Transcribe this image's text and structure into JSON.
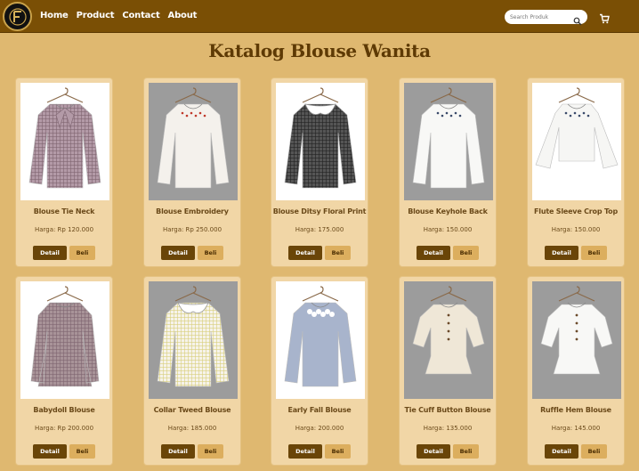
{
  "nav": {
    "links": [
      "Home",
      "Product",
      "Contact",
      "About"
    ],
    "search_placeholder": "Search Produk"
  },
  "page_title": "Katalog Blouse Wanita",
  "products": [
    {
      "name": "Blouse Tie Neck",
      "price": "Harga: Rp 120.000",
      "detail_label": "Detail",
      "buy_label": "Beli",
      "bg": "#ffffff",
      "color": "#b39aa7",
      "pattern": "plaid",
      "style": "tie"
    },
    {
      "name": "Blouse Embroidery",
      "price": "Harga: Rp 250.000",
      "detail_label": "Detail",
      "buy_label": "Beli",
      "bg": "#9c9c9c",
      "color": "#f4f1ec",
      "pattern": "embroidery",
      "style": "peasant"
    },
    {
      "name": "Blouse Ditsy Floral Print",
      "price": "Harga: 175.000",
      "detail_label": "Detail",
      "buy_label": "Beli",
      "bg": "#ffffff",
      "color": "#555555",
      "pattern": "gingham",
      "style": "collar"
    },
    {
      "name": "Blouse Keyhole Back",
      "price": "Harga: 150.000",
      "detail_label": "Detail",
      "buy_label": "Beli",
      "bg": "#9c9c9c",
      "color": "#f8f8f6",
      "pattern": "neckprint",
      "style": "plain"
    },
    {
      "name": "Flute Sleeve Crop Top",
      "price": "Harga: 150.000",
      "detail_label": "Detail",
      "buy_label": "Beli",
      "bg": "#ffffff",
      "color": "#f6f6f4",
      "pattern": "vline",
      "style": "flute"
    },
    {
      "name": "Babydoll Blouse",
      "price": "Harga: Rp 200.000",
      "detail_label": "Detail",
      "buy_label": "Beli",
      "bg": "#ffffff",
      "color": "#a89398",
      "pattern": "plaid",
      "style": "babydoll"
    },
    {
      "name": "Collar Tweed Blouse",
      "price": "Harga: 185.000",
      "detail_label": "Detail",
      "buy_label": "Beli",
      "bg": "#9c9c9c",
      "color": "#f6f3ea",
      "pattern": "tweed",
      "style": "collar"
    },
    {
      "name": "Early Fall Blouse",
      "price": "Harga: 200.000",
      "detail_label": "Detail",
      "buy_label": "Beli",
      "bg": "#ffffff",
      "color": "#a8b4cc",
      "pattern": "lace",
      "style": "peasant"
    },
    {
      "name": "Tie Cuff Button Blouse",
      "price": "Harga: 135.000",
      "detail_label": "Detail",
      "buy_label": "Beli",
      "bg": "#9c9c9c",
      "color": "#efe7d7",
      "pattern": "buttons",
      "style": "peplum"
    },
    {
      "name": "Ruffle Hem Blouse",
      "price": "Harga: 145.000",
      "detail_label": "Detail",
      "buy_label": "Beli",
      "bg": "#9c9c9c",
      "color": "#f8f8f6",
      "pattern": "buttons",
      "style": "peplum"
    }
  ],
  "colors": {
    "navbar": "#7a4f05",
    "page_bg": "#dfb870",
    "card_bg": "#f1d6a6",
    "detail_button": "#6a4508",
    "buy_button": "#dcae5e",
    "title": "#5e3a05"
  },
  "icons": {
    "logo": "brand-logo",
    "search": "search-icon",
    "cart": "cart-icon"
  }
}
